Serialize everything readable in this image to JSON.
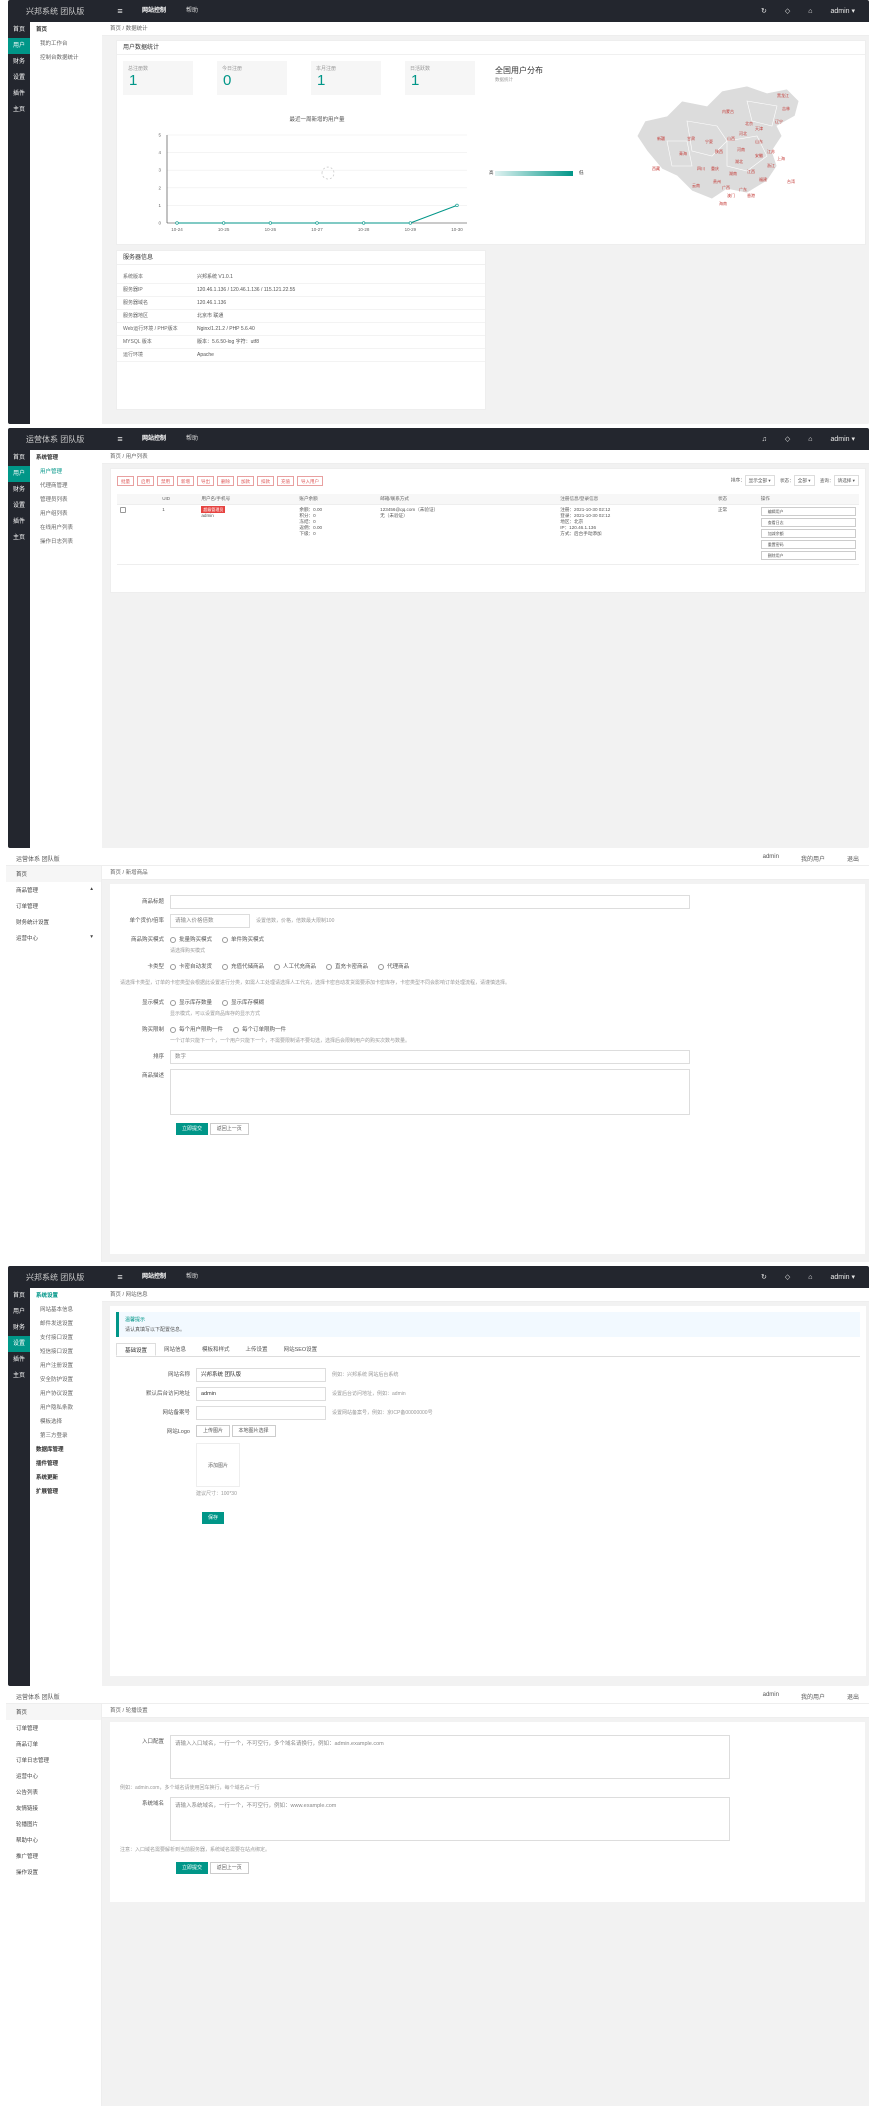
{
  "brand": "兴邦系统 团队版",
  "brand_light": "运营体系 团队版",
  "top_nav": [
    "网站控制",
    "帮助"
  ],
  "admin": "admin",
  "top_links": [
    "admin",
    "我的用户",
    "退出"
  ],
  "rail": [
    "首页",
    "用户",
    "财务",
    "设置",
    "插件",
    "主页"
  ],
  "s1": {
    "subnav": [
      "首页",
      "我的工作台",
      "控制台数据统计"
    ],
    "crumb": "首页 / 数据统计",
    "card_title": "用户数据统计",
    "stats": [
      {
        "label": "总注册数",
        "value": "1"
      },
      {
        "label": "今日注册",
        "value": "0"
      },
      {
        "label": "本月注册",
        "value": "1"
      },
      {
        "label": "日活跃数",
        "value": "1"
      }
    ],
    "map_title": "全国用户分布",
    "map_sub": "数据统计",
    "map_low": "高",
    "map_high": "低",
    "provinces": [
      "黑龙江",
      "吉林",
      "辽宁",
      "北京",
      "天津",
      "河北",
      "山东",
      "江苏",
      "上海",
      "浙江",
      "福建",
      "广东",
      "台湾",
      "香港",
      "澳门",
      "海南",
      "新疆",
      "西藏",
      "青海",
      "甘肃",
      "宁夏",
      "内蒙古",
      "山西",
      "陕西",
      "河南",
      "湖北",
      "湖南",
      "江西",
      "安徽",
      "四川",
      "重庆",
      "贵州",
      "云南",
      "广西"
    ],
    "sys_title": "服务器信息",
    "sys_rows": [
      {
        "k": "系统版本",
        "v": "兴邦系统 V1.0.1"
      },
      {
        "k": "服务器IP",
        "v": "120.46.1.136 / 120.46.1.136 / 115.121.22.55"
      },
      {
        "k": "服务器域名",
        "v": "120.46.1.136"
      },
      {
        "k": "服务器地区",
        "v": "北京市 联通"
      },
      {
        "k": "Web运行环境 / PHP版本",
        "v": "Nginx/1.21.2 / PHP 5.6.40"
      },
      {
        "k": "MYSQL 版本",
        "v": "版本：5.6.50-log  字符：utf8"
      },
      {
        "k": "运行环境",
        "v": "Apache"
      }
    ]
  },
  "chart_data": {
    "type": "line",
    "title": "最近一周新增的用户量",
    "categories": [
      "10-24",
      "10-25",
      "10-26",
      "10-27",
      "10-28",
      "10-29",
      "10-30"
    ],
    "values": [
      0,
      0,
      0,
      0,
      0,
      0,
      1
    ],
    "ylim": [
      0,
      5
    ],
    "yticks": [
      "5",
      "4",
      "3",
      "2",
      "1",
      "0"
    ]
  },
  "s2": {
    "subnav_head": "系统管理",
    "subnav": [
      "用户管理",
      "代理商管理",
      "管理员列表",
      "用户组列表",
      "在线用户列表",
      "操作日志列表"
    ],
    "crumb": "首页 / 用户列表",
    "actions": [
      "批量",
      "启用",
      "禁用",
      "新增",
      "导出",
      "删除",
      "加款",
      "扣款",
      "充值",
      "导入用户"
    ],
    "filter_sort": "排序：",
    "filter_sort_val": "显示全部",
    "filter_status": "状态：",
    "filter_status_val": "全部",
    "filter_search": "查询：",
    "filter_search_val": "请选择",
    "headers": [
      "",
      "UID",
      "用户名/手机号",
      "账户余额",
      "邮箱/联系方式",
      "注册信息/登录信息",
      "状态",
      "操作"
    ],
    "row": {
      "uid": "1",
      "badge": "超级管理员",
      "name": "admin",
      "balance": [
        "余额：0.00",
        "积分：0",
        "冻结：0",
        "返佣：0.00",
        "下级：0"
      ],
      "contact": [
        "123456@qq.com（未验证）",
        "无（未验证）"
      ],
      "reg": [
        "注册：2021-10-30 02:12",
        "登录：2021-10-30 02:12",
        "地区：北京",
        "IP：120.46.1.136",
        "方式：后台手动添加"
      ],
      "status": "正常",
      "ops": [
        "编辑用户",
        "查看日志",
        "加减余额",
        "重置密码",
        "删除用户"
      ]
    }
  },
  "s3": {
    "side": [
      "首页",
      "商品管理",
      "订单管理",
      "财务统计设置",
      "运营中心"
    ],
    "crumb": "首页 / 新增商品",
    "f_title": "商品标题",
    "f_price": "单个货价/倍率",
    "f_price_val": "请输入价格倍数",
    "f_price_hint": "设置倍数，价格，倍数最大限制100",
    "f_mode": "商品购买模式",
    "f_mode_opts": [
      "批量购买模式",
      "单件购买模式"
    ],
    "f_mode_hint": "请选择购买模式",
    "f_type": "卡类型",
    "f_type_opts": [
      "卡密自动发货",
      "充值代储商品",
      "人工代充商品",
      "直充卡密商品",
      "代理商品"
    ],
    "f_type_hint": "请选择卡类型，订单的卡密类型会根据此设置进行分类，如需人工处理请选择人工代充，选择卡密自动发货需要添加卡密库存，卡密类型不同会影响订单处理流程，请谨慎选择。",
    "f_show": "显示模式",
    "f_show_opts": [
      "显示库存数量",
      "显示库存模糊"
    ],
    "f_show_hint": "显示模式，可以设置商品库存的显示方式",
    "f_limit": "购买限制",
    "f_limit_opts": [
      "每个用户限购一件",
      "每个订单限购一件"
    ],
    "f_limit_hint": "一个订单只能下一个，一个用户只能下一个，不需要限制请不要勾选，选择后会限制用户的购买次数与数量。",
    "f_sort": "排序",
    "f_sort_val": "数字",
    "f_desc": "商品描述",
    "submit": "立即提交",
    "back": "返回上一页"
  },
  "s4": {
    "subnav_head": "系统设置",
    "subnav": [
      "网站基本信息",
      "邮件发送设置",
      "支付接口设置",
      "短信接口设置",
      "用户注册设置",
      "安全防护设置",
      "用户协议设置",
      "用户隐私条款",
      "模板选择",
      "第三方登录"
    ],
    "subnav2": [
      "数据库管理",
      "插件管理",
      "系统更新",
      "扩展管理"
    ],
    "crumb": "首页 / 网站信息",
    "notice_t": "温馨提示",
    "notice_b": "请认真填写以下配置信息。",
    "tabs": [
      "基础设置",
      "网站信息",
      "模板和样式",
      "上传设置",
      "网站SEO设置"
    ],
    "f_name": "网站名称",
    "f_name_val": "兴邦系统 团队版",
    "f_name_hint": "例如：兴邦系统 网站后台系统",
    "f_url": "默认后台访问地址",
    "f_url_val": "admin",
    "f_url_hint": "设置后台访问地址，例如：admin",
    "f_icp": "网站备案号",
    "f_icp_hint": "设置网站备案号，例如：京ICP备00000000号",
    "f_logo": "网站Logo",
    "f_logo_btns": [
      "上传图片",
      "本地图片选择"
    ],
    "f_logo_ph": "添加图片",
    "f_logo_hint": "建议尺寸：100*30",
    "save": "保存"
  },
  "s5": {
    "side_a": [
      "首页",
      "订单管理"
    ],
    "side_b": [
      "商品订单",
      "订单日志管理"
    ],
    "side_c": [
      "运营中心"
    ],
    "side_d": [
      "公告列表",
      "友情链接",
      "轮播图片",
      "帮助中心",
      "推广管理",
      "操作设置"
    ],
    "crumb": "首页 / 轮播设置",
    "f1": "入口配置",
    "f1_ph": "请输入入口域名，一行一个，不可空行，多个域名请换行，例如：admin.example.com",
    "f1_hint": "例如：admin.com，多个域名请使用回车换行，每个域名占一行",
    "f2": "系统域名",
    "f2_ph": "请输入系统域名，一行一个，不可空行，例如：www.example.com",
    "f2_hint": "注意：入口域名需要解析到当前服务器，系统域名需要在站点绑定。",
    "submit": "立即提交",
    "back": "返回上一页"
  }
}
